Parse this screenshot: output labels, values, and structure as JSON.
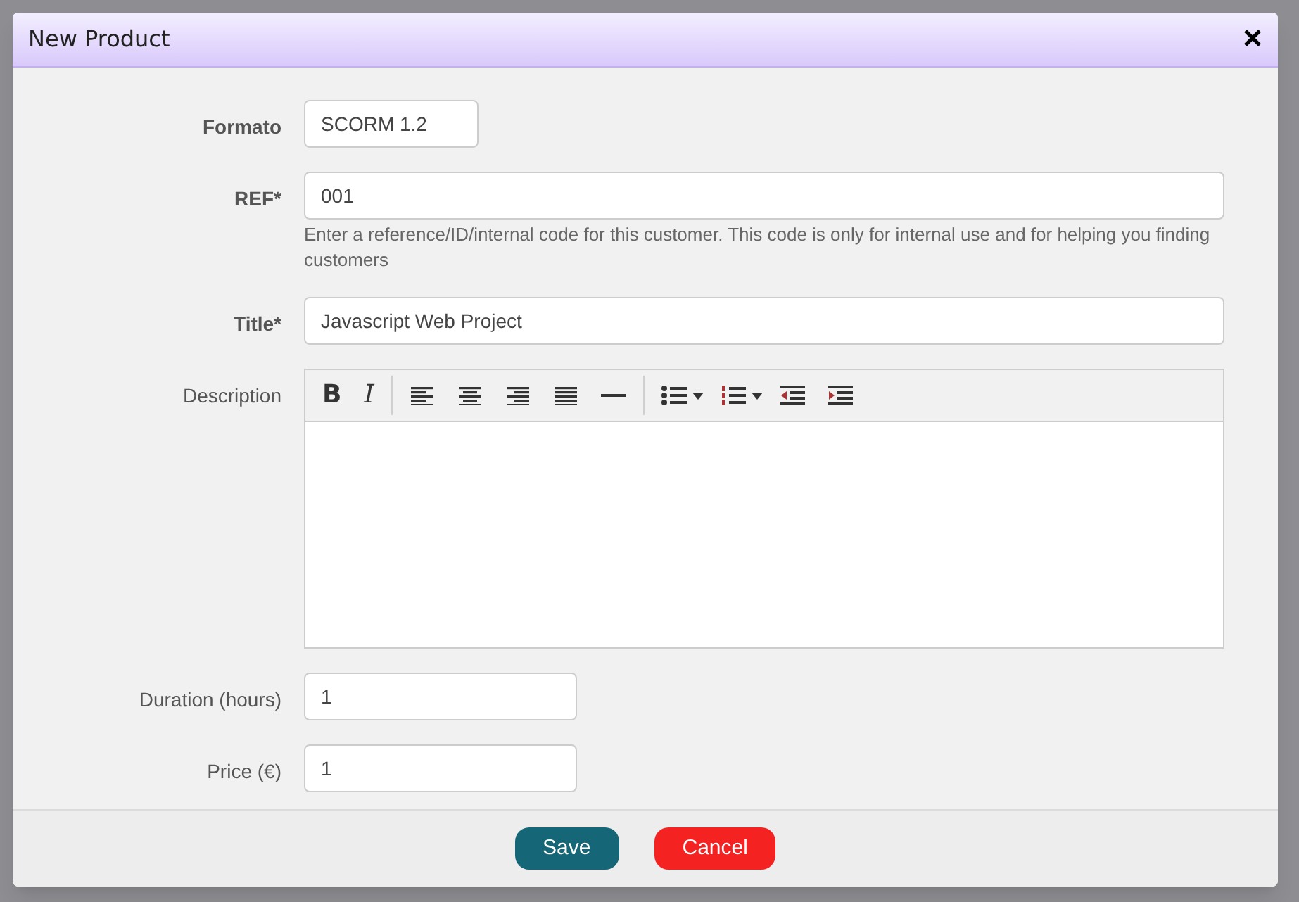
{
  "window": {
    "title": "New Product",
    "close": "×"
  },
  "fields": [
    {
      "kind": "input",
      "label": "Formato",
      "bold": true,
      "value": "SCORM 1.2"
    },
    {
      "kind": "input",
      "label": "REF*",
      "bold": true,
      "value": "001",
      "help": "Enter a reference/ID/internal code for this customer. This code is only for internal use and for helping you finding customers"
    },
    {
      "kind": "input",
      "label": "Title*",
      "bold": true,
      "value": "Javascript Web Project"
    },
    {
      "kind": "editor",
      "label": "Description",
      "bold": false,
      "toolbar": [
        {
          "kind": "bold",
          "label": "B"
        },
        {
          "kind": "italic",
          "label": "I"
        },
        {
          "kind": "separator"
        },
        {
          "kind": "align-left"
        },
        {
          "kind": "align-center"
        },
        {
          "kind": "align-right"
        },
        {
          "kind": "justify"
        },
        {
          "kind": "rule"
        },
        {
          "kind": "separator"
        },
        {
          "kind": "bullets"
        },
        {
          "kind": "caret"
        },
        {
          "kind": "numbers"
        },
        {
          "kind": "caret"
        },
        {
          "kind": "outdent"
        },
        {
          "kind": "indent"
        }
      ]
    },
    {
      "kind": "input",
      "label": "Duration (hours)",
      "bold": false,
      "value": "1"
    },
    {
      "kind": "input",
      "label": "Price (€)",
      "bold": false,
      "value": "1"
    }
  ],
  "buttons": [
    {
      "label": "Save",
      "kind": "primary"
    },
    {
      "label": "Cancel",
      "kind": "danger"
    }
  ]
}
